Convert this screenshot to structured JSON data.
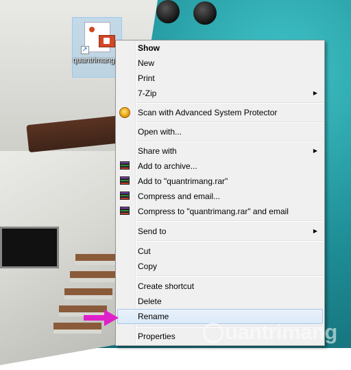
{
  "desktop": {
    "icon": {
      "label": "quantrimang.pps",
      "icon_name": "powerpoint-slideshow-file-icon"
    }
  },
  "context_menu": {
    "items": [
      {
        "label": "Show",
        "bold": true
      },
      {
        "label": "New"
      },
      {
        "label": "Print"
      },
      {
        "label": "7-Zip",
        "submenu": true
      },
      {
        "label": "Scan with Advanced System Protector",
        "icon": "shield-icon"
      },
      {
        "label": "Open with..."
      },
      {
        "label": "Share with",
        "submenu": true
      },
      {
        "label": "Add to archive...",
        "icon": "winrar-icon"
      },
      {
        "label": "Add to \"quantrimang.rar\"",
        "icon": "winrar-icon"
      },
      {
        "label": "Compress and email...",
        "icon": "winrar-icon"
      },
      {
        "label": "Compress to \"quantrimang.rar\" and email",
        "icon": "winrar-icon"
      },
      {
        "label": "Send to",
        "submenu": true
      },
      {
        "label": "Cut"
      },
      {
        "label": "Copy"
      },
      {
        "label": "Create shortcut"
      },
      {
        "label": "Delete"
      },
      {
        "label": "Rename",
        "highlighted": true
      },
      {
        "label": "Properties"
      }
    ],
    "submenu_glyph": "▶"
  },
  "pointer": {
    "icon_name": "magenta-arrow-icon",
    "color": "#e020c8"
  },
  "watermark": {
    "text": "uantrimang"
  },
  "colors": {
    "menu_bg": "#f0f0f0",
    "highlight": "#dbe9f8",
    "highlight_border": "#a8c7ea"
  }
}
